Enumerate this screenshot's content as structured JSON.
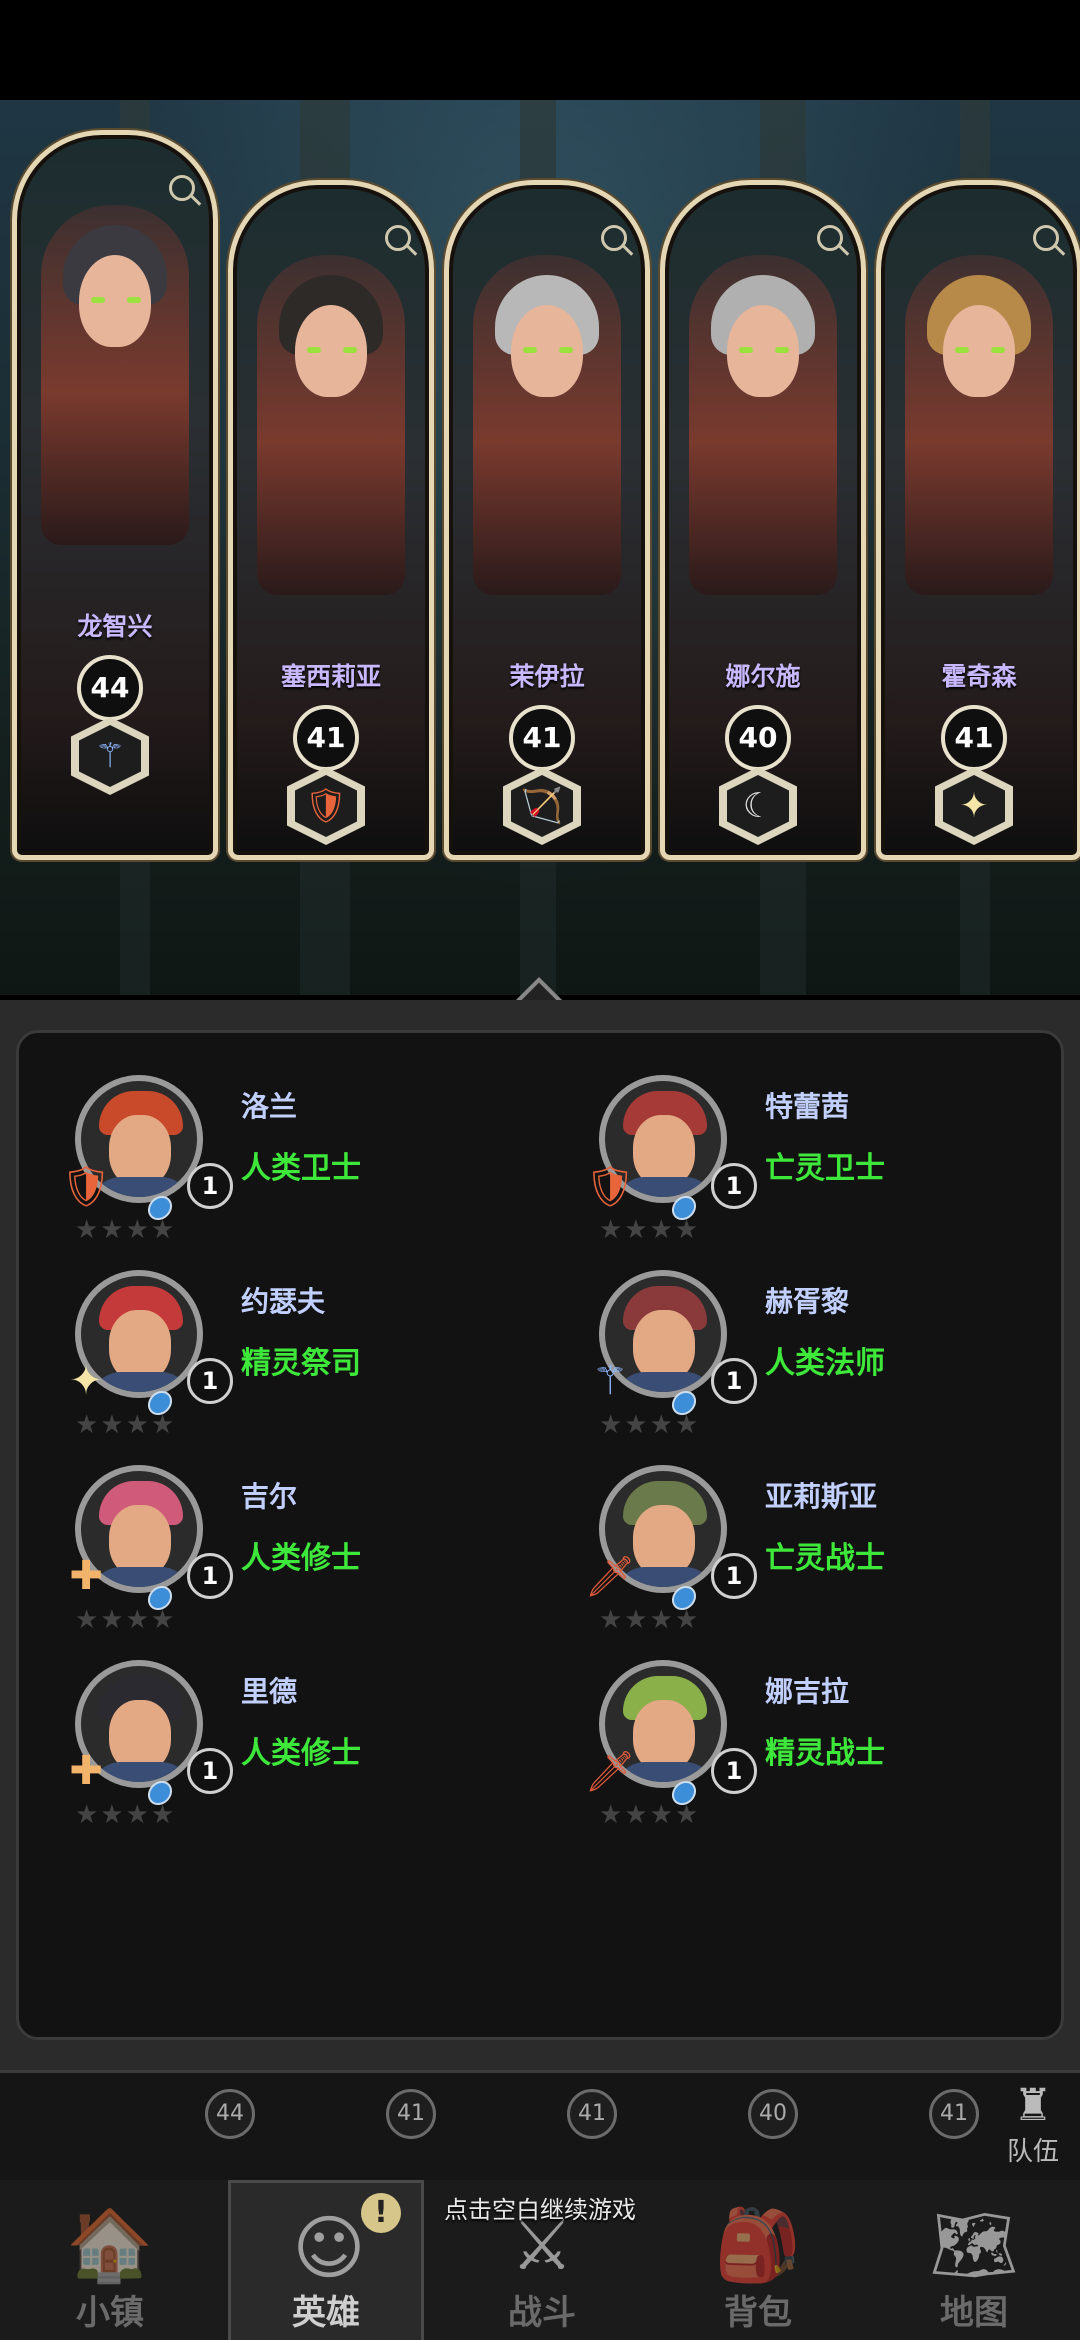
{
  "top_cards": [
    {
      "name": "龙智兴",
      "level": "44",
      "class_icon": "staff-icon",
      "hair": "#3a3a40",
      "accent": "#a7c8ff"
    },
    {
      "name": "塞西莉亚",
      "level": "41",
      "class_icon": "shield-icon",
      "hair": "#2e2a28",
      "accent": "#f07a3a"
    },
    {
      "name": "茉伊拉",
      "level": "41",
      "class_icon": "bow-icon",
      "hair": "#b8b8b8",
      "accent": "#8ccf3a"
    },
    {
      "name": "娜尔施",
      "level": "40",
      "class_icon": "scythe-icon",
      "hair": "#b0b0b0",
      "accent": "#e0e0e0"
    },
    {
      "name": "霍奇森",
      "level": "41",
      "class_icon": "holy-star-icon",
      "hair": "#b88a4a",
      "accent": "#f4e8b0"
    }
  ],
  "roster": [
    {
      "name": "洛兰",
      "class": "人类卫士",
      "level": "1",
      "class_icon": "shield-icon",
      "hair": "#c84a2a"
    },
    {
      "name": "特蕾茜",
      "class": "亡灵卫士",
      "level": "1",
      "class_icon": "shield-icon",
      "hair": "#a63a36"
    },
    {
      "name": "约瑟夫",
      "class": "精灵祭司",
      "level": "1",
      "class_icon": "holy-star-icon",
      "hair": "#c43a3a"
    },
    {
      "name": "赫胥黎",
      "class": "人类法师",
      "level": "1",
      "class_icon": "staff-icon",
      "hair": "#8a3a3a"
    },
    {
      "name": "吉尔",
      "class": "人类修士",
      "level": "1",
      "class_icon": "holy-cross-icon",
      "hair": "#d05a7a"
    },
    {
      "name": "亚莉斯亚",
      "class": "亡灵战士",
      "level": "1",
      "class_icon": "sword-icon",
      "hair": "#6a7a4a"
    },
    {
      "name": "里德",
      "class": "人类修士",
      "level": "1",
      "class_icon": "holy-cross-icon",
      "hair": "#2a2a30"
    },
    {
      "name": "娜吉拉",
      "class": "精灵战士",
      "level": "1",
      "class_icon": "sword-icon",
      "hair": "#8ab04a"
    }
  ],
  "team_strip": {
    "levels": [
      "44",
      "41",
      "41",
      "40",
      "41"
    ],
    "team_label": "队伍"
  },
  "hint": "点击空白继续游戏",
  "nav": [
    {
      "label": "小镇",
      "icon": "town-icon",
      "active": false
    },
    {
      "label": "英雄",
      "icon": "hero-icon",
      "active": true,
      "alert": "!"
    },
    {
      "label": "战斗",
      "icon": "swords-icon",
      "active": false
    },
    {
      "label": "背包",
      "icon": "backpack-icon",
      "active": false
    },
    {
      "label": "地图",
      "icon": "map-icon",
      "active": false
    }
  ]
}
